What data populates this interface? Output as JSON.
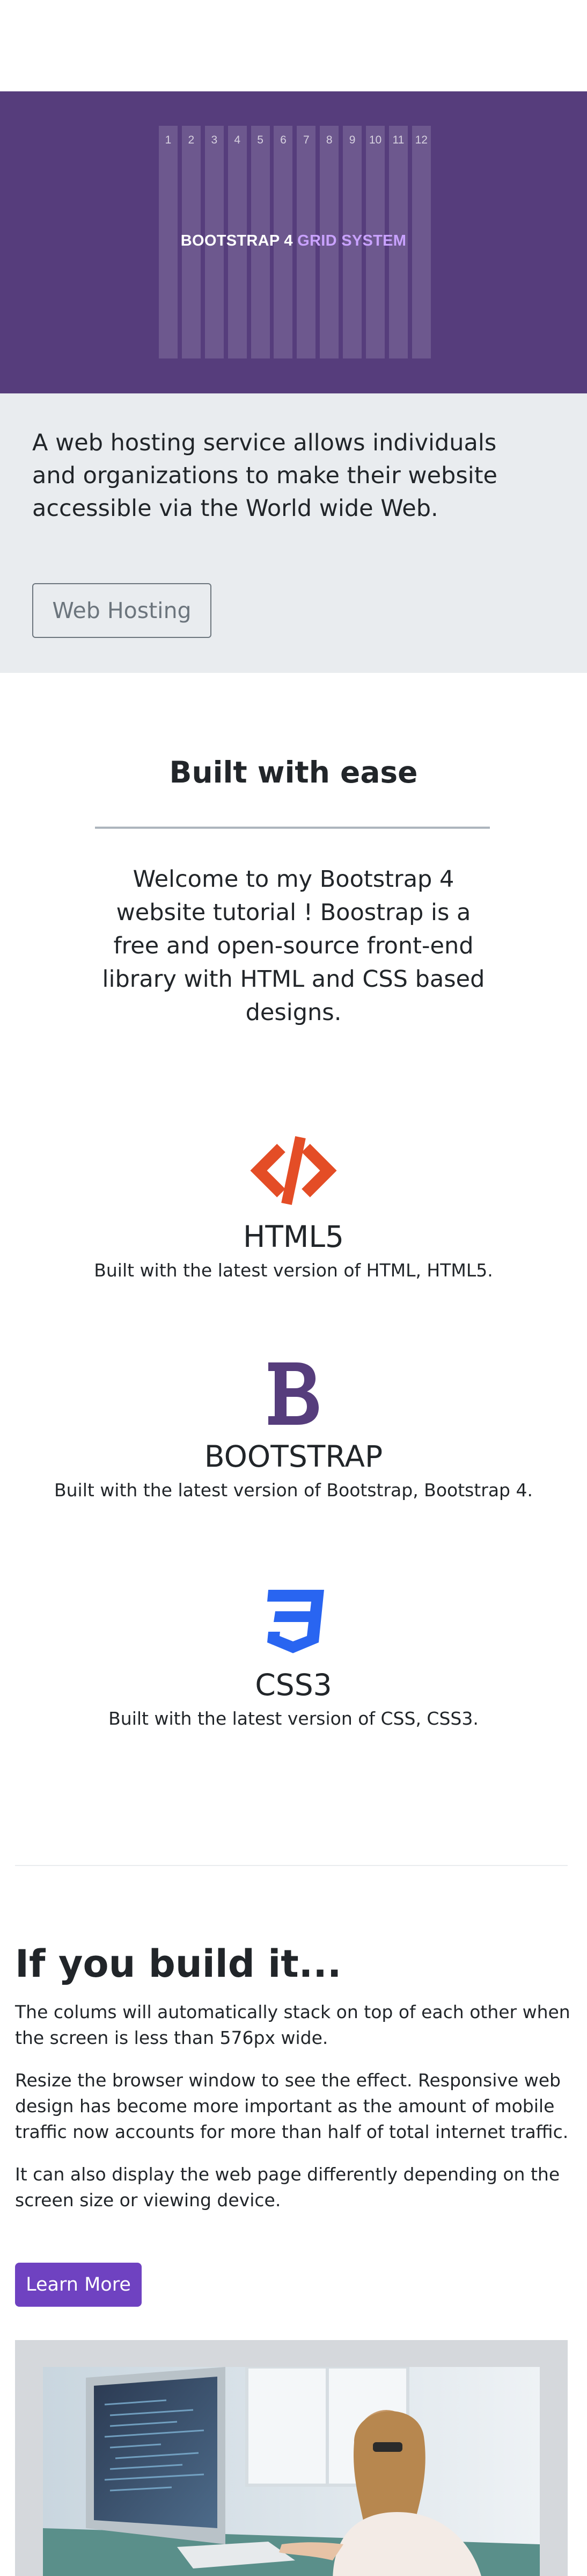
{
  "hero": {
    "columns": [
      "1",
      "2",
      "3",
      "4",
      "5",
      "6",
      "7",
      "8",
      "9",
      "10",
      "11",
      "12"
    ],
    "title_main": "BOOTSTRAP 4",
    "title_accent": "GRID SYSTEM",
    "colors": {
      "background": "#563d7c",
      "accent": "#c9a2ff"
    }
  },
  "jumbotron": {
    "lead": "A web hosting service allows individuals and organizations to make their website accessible via the World wide Web.",
    "button_label": "Web Hosting"
  },
  "welcome": {
    "title": "Built with ease",
    "text": "Welcome to my Bootstrap 4 website tutorial ! Boostrap is a free and open-source front-end library with HTML and CSS based designs."
  },
  "features": [
    {
      "icon": "html5-code-icon",
      "name": "HTML5",
      "desc": "Built with the latest version of HTML, HTML5.",
      "color": "#e44d26"
    },
    {
      "icon": "bootstrap-icon",
      "name": "BOOTSTRAP",
      "desc": "Built with the latest version of Bootstrap, Bootstrap 4.",
      "color": "#563d7c"
    },
    {
      "icon": "css3-icon",
      "name": "CSS3",
      "desc": "Built with the latest version of CSS, CSS3.",
      "color": "#2965f1"
    }
  ],
  "build": {
    "title": "If you build it...",
    "paragraphs": [
      "The colums will automatically stack on top of each other when the screen is less than 576px wide.",
      "Resize the browser window to see the effect. Responsive web design has become more important as the amount of mobile traffic now accounts for more than half of total internet traffic.",
      "It can also display the web page differently depending on the screen size or viewing device."
    ],
    "button_label": "Learn More",
    "button_color": "#6f42c1"
  },
  "image": {
    "icon": "workspace-photo"
  }
}
